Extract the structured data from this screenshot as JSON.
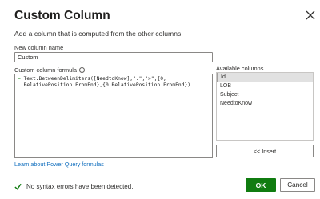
{
  "dialog": {
    "title": "Custom Column",
    "description": "Add a column that is computed from the other columns."
  },
  "new_column": {
    "label": "New column name",
    "value": "Custom"
  },
  "formula": {
    "label": "Custom column formula",
    "info_glyph": "i",
    "line1_prefix": "= ",
    "line1": "Text.BetweenDelimiters([NeedtoKnow],\".\",\">\",{0,",
    "line2": "  RelativePosition.FromEnd},{0,RelativePosition.FromEnd})"
  },
  "available_columns": {
    "label": "Available columns",
    "items": [
      "Id",
      "LOB",
      "Subject",
      "NeedtoKnow"
    ],
    "selected_index": 0
  },
  "insert_button": "<< Insert",
  "learn_link": "Learn about Power Query formulas",
  "status": {
    "text": "No syntax errors have been detected.",
    "icon": "checkmark-icon",
    "color": "#107c10"
  },
  "buttons": {
    "ok": "OK",
    "cancel": "Cancel"
  },
  "colors": {
    "accent": "#107c10",
    "link": "#106ebe"
  }
}
